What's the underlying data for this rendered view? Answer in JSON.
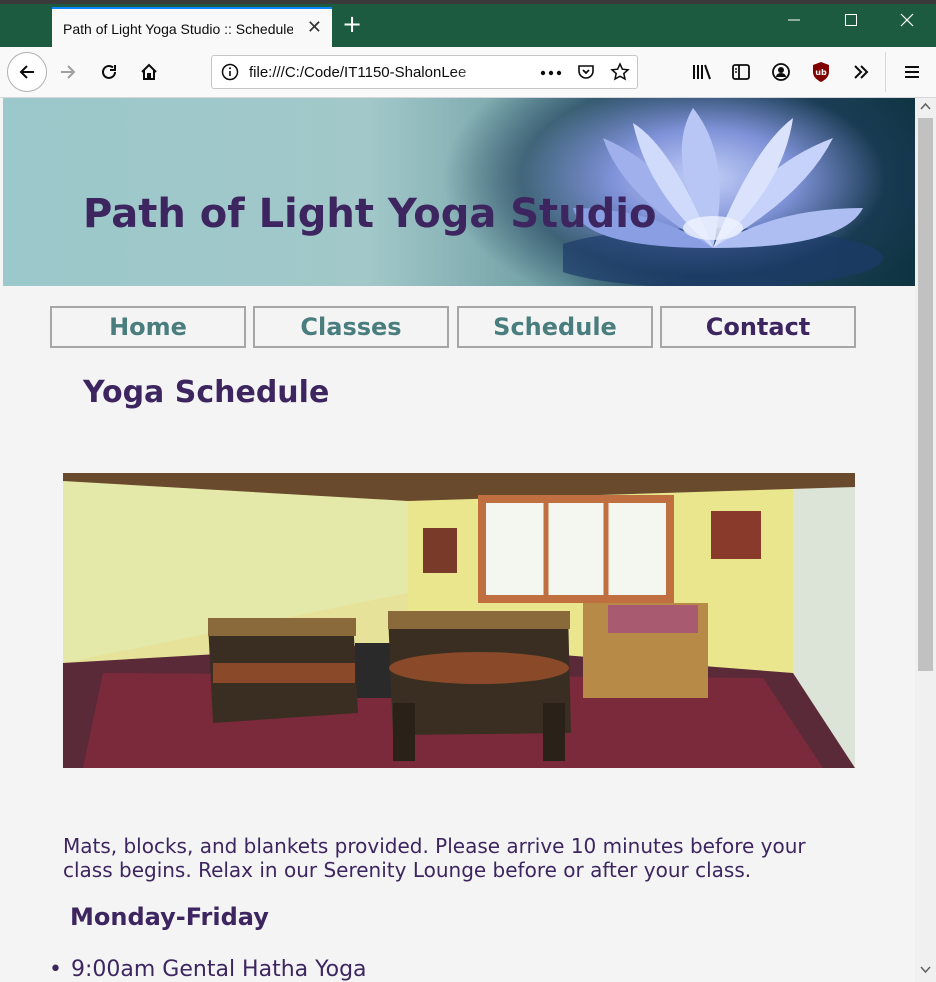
{
  "browser": {
    "tab_title": "Path of Light Yoga Studio :: Schedule",
    "tab_close": "✕",
    "new_tab": "+",
    "url": "file:///C:/Code/IT1150-ShalonLee"
  },
  "site": {
    "title": "Path of Light Yoga Studio",
    "nav": [
      {
        "label": "Home"
      },
      {
        "label": "Classes"
      },
      {
        "label": "Schedule"
      },
      {
        "label": "Contact"
      }
    ]
  },
  "main": {
    "heading": "Yoga Schedule",
    "intro": "Mats, blocks, and blankets provided. Please arrive 10 minutes before your class begins. Relax in our Serenity Lounge before or after your class.",
    "section_heading": "Monday-Friday",
    "schedule": [
      {
        "item": "9:00am Gental Hatha Yoga"
      }
    ]
  },
  "colors": {
    "accent": "#3d2660",
    "nav_text": "#4a7d7d",
    "tab_bar": "#1c5b3f"
  }
}
